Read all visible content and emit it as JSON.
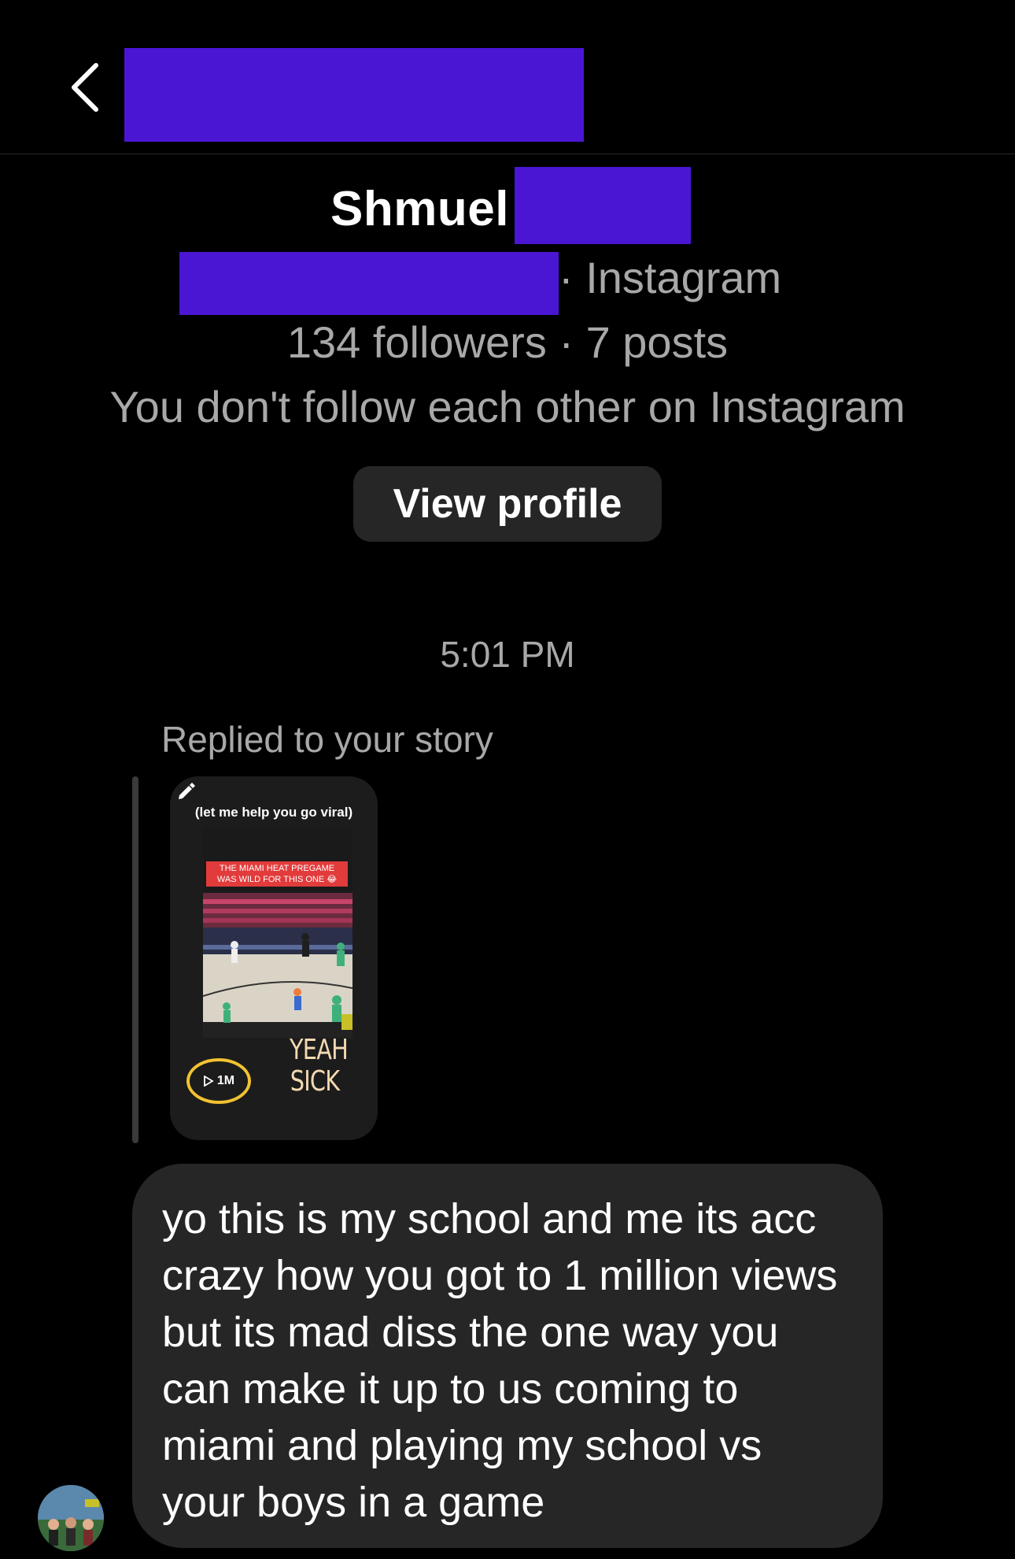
{
  "header": {
    "back_label": "back"
  },
  "profile": {
    "name": "Shmuel",
    "platform": "· Instagram",
    "stats": "134 followers · 7 posts",
    "follow_note": "You don't follow each other on Instagram",
    "view_profile_label": "View profile"
  },
  "conversation": {
    "timestamp": "5:01 PM",
    "reply_label": "Replied to your story",
    "story": {
      "overlay_text": "(let me help you go viral)",
      "video_caption": "THE MIAMI HEAT PREGAME WAS WILD FOR THIS ONE 😂",
      "view_count": "1M",
      "handwriting": "YEAH SICK"
    },
    "message": "yo this is my school and me its acc crazy how you got to 1 million views but its mad diss the one way you can make it up to us coming to miami and playing my school vs your boys in a game"
  },
  "icons": {
    "back": "chevron-left-icon",
    "edit": "pencil-icon",
    "play": "play-icon",
    "avatar": "avatar-icon"
  },
  "colors": {
    "background": "#000000",
    "bubble": "#262626",
    "secondary_text": "#a8a8a8",
    "redaction": "#4a16d4"
  }
}
